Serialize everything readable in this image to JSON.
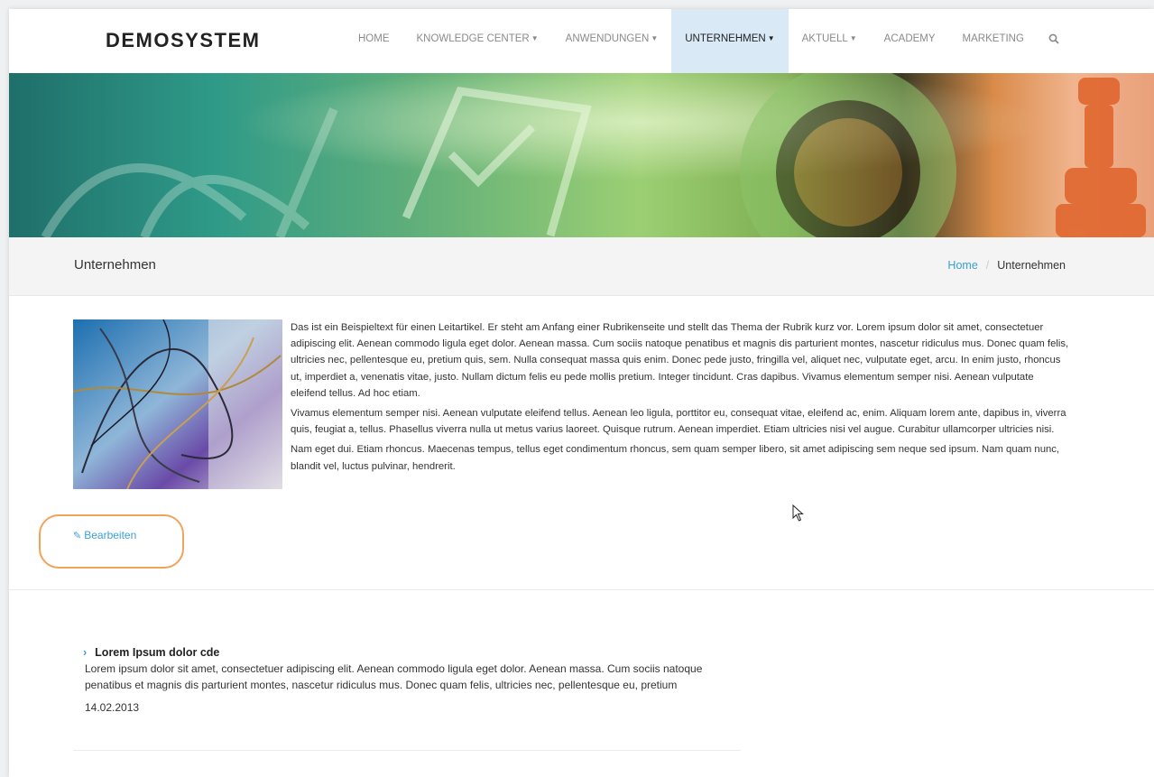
{
  "brand": {
    "logo_text": "DEMOSYSTEM"
  },
  "nav": {
    "items": [
      {
        "label": "HOME",
        "has_caret": false,
        "active": false
      },
      {
        "label": "KNOWLEDGE CENTER",
        "has_caret": true,
        "active": false
      },
      {
        "label": "ANWENDUNGEN",
        "has_caret": true,
        "active": false
      },
      {
        "label": "UNTERNEHMEN",
        "has_caret": true,
        "active": true
      },
      {
        "label": "AKTUELL",
        "has_caret": true,
        "active": false
      },
      {
        "label": "ACADEMY",
        "has_caret": false,
        "active": false
      },
      {
        "label": "MARKETING",
        "has_caret": false,
        "active": false
      }
    ],
    "search_icon": "search-icon"
  },
  "page": {
    "title": "Unternehmen",
    "breadcrumb": {
      "home": "Home",
      "separator": "/",
      "current": "Unternehmen"
    }
  },
  "article": {
    "paragraphs": [
      "Das ist ein Beispieltext für einen Leitartikel. Er steht am Anfang einer Rubrikenseite und stellt das Thema der Rubrik kurz vor. Lorem ipsum dolor sit amet, consectetuer adipiscing elit. Aenean commodo ligula eget dolor. Aenean massa. Cum sociis natoque penatibus et magnis dis parturient montes, nascetur ridiculus mus. Donec quam felis, ultricies nec, pellentesque eu, pretium quis, sem. Nulla consequat massa quis enim. Donec pede justo, fringilla vel, aliquet nec, vulputate eget, arcu. In enim justo, rhoncus ut, imperdiet a, venenatis vitae, justo. Nullam dictum felis eu pede mollis pretium. Integer tincidunt. Cras dapibus. Vivamus elementum semper nisi. Aenean vulputate eleifend tellus. Ad hoc etiam.",
      "Vivamus elementum semper nisi. Aenean vulputate eleifend tellus. Aenean leo ligula, porttitor eu, consequat vitae, eleifend ac, enim. Aliquam lorem ante, dapibus in, viverra quis, feugiat a, tellus. Phasellus viverra nulla ut metus varius laoreet. Quisque rutrum. Aenean imperdiet. Etiam ultricies nisi vel augue. Curabitur ullamcorper ultricies nisi.",
      "Nam eget dui. Etiam rhoncus. Maecenas tempus, tellus eget condimentum rhoncus, sem quam semper libero, sit amet adipiscing sem neque sed ipsum. Nam quam nunc, blandit vel, luctus pulvinar, hendrerit."
    ],
    "edit_label": "Bearbeiten",
    "edit_icon": "edit-icon"
  },
  "news": {
    "items": [
      {
        "title": "Lorem Ipsum dolor cde",
        "text": "Lorem ipsum dolor sit amet, consectetuer adipiscing elit. Aenean commodo ligula eget dolor. Aenean massa. Cum sociis natoque penatibus et magnis dis parturient montes, nascetur ridiculus mus. Donec quam felis, ultricies nec, pellentesque eu, pretium",
        "date": "14.02.2013"
      }
    ]
  },
  "colors": {
    "accent": "#3aa0d8",
    "active_nav_bg": "#d9e9f6",
    "highlight_ring": "#f0a35a"
  }
}
